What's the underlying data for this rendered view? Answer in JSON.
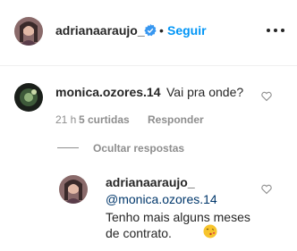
{
  "header": {
    "username": "adrianaaraujo_",
    "separator": "•",
    "follow_label": "Seguir",
    "verified_icon": "verified-badge-icon",
    "more_icon": "more-options-icon",
    "verified_color": "#3897f0",
    "follow_color": "#0095f6"
  },
  "comment": {
    "username": "monica.ozores.14",
    "text": "Vai pra onde?",
    "time": "21 h",
    "likes": "5 curtidas",
    "reply_label": "Responder",
    "like_icon": "heart-icon"
  },
  "replies_toggle": {
    "label": "Ocultar respostas"
  },
  "reply": {
    "username": "adrianaaraujo_",
    "mention": "@monica.ozores.14",
    "line1": "Tenho mais alguns meses",
    "line2": "de contrato.",
    "emoji_icon": "kissing-face-emoji-icon",
    "like_icon": "heart-icon"
  }
}
